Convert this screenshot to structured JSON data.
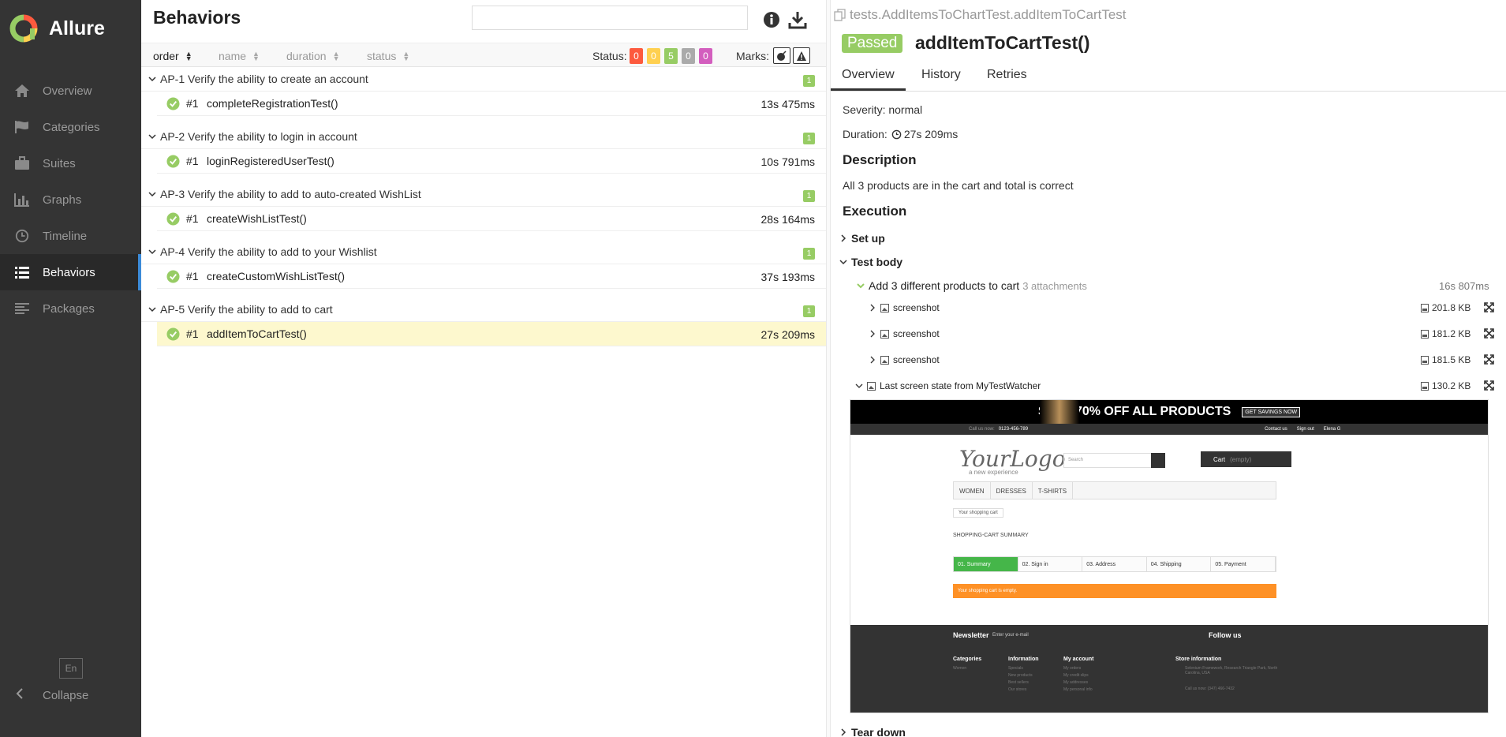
{
  "app": {
    "name": "Allure"
  },
  "colors": {
    "sidebar": "#343434",
    "accent": "#3b8ad8",
    "passed": "#97cc64",
    "failed": "#fd5a3e",
    "broken": "#ffd050",
    "skipped": "#aaaaaa",
    "unknown": "#d35ebe",
    "selected_row": "#fdf8ce"
  },
  "sidebar": {
    "items": [
      {
        "label": "Overview",
        "icon": "home-icon"
      },
      {
        "label": "Categories",
        "icon": "flag-icon"
      },
      {
        "label": "Suites",
        "icon": "briefcase-icon"
      },
      {
        "label": "Graphs",
        "icon": "bar-chart-icon"
      },
      {
        "label": "Timeline",
        "icon": "clock-icon"
      },
      {
        "label": "Behaviors",
        "icon": "list-icon",
        "active": true
      },
      {
        "label": "Packages",
        "icon": "align-left-icon"
      }
    ],
    "language": "En",
    "collapse": "Collapse"
  },
  "behaviors": {
    "title": "Behaviors",
    "search_value": "",
    "sort": {
      "order": "order",
      "name": "name",
      "duration": "duration",
      "status": "status"
    },
    "status_label": "Status:",
    "status_counts": {
      "failed": "0",
      "broken": "0",
      "passed": "5",
      "skipped": "0",
      "unknown": "0"
    },
    "marks_label": "Marks:",
    "groups": [
      {
        "name": "AP-1 Verify the ability to create an account",
        "count": "1",
        "test": {
          "num": "#1",
          "name": "completeRegistrationTest()",
          "duration": "13s 475ms"
        }
      },
      {
        "name": "AP-2 Verify the ability to login in account",
        "count": "1",
        "test": {
          "num": "#1",
          "name": "loginRegisteredUserTest()",
          "duration": "10s 791ms"
        }
      },
      {
        "name": "AP-3 Verify the ability to add to auto-created WishList",
        "count": "1",
        "test": {
          "num": "#1",
          "name": "createWishListTest()",
          "duration": "28s 164ms"
        }
      },
      {
        "name": "AP-4 Verify the ability to add to your Wishlist",
        "count": "1",
        "test": {
          "num": "#1",
          "name": "createCustomWishListTest()",
          "duration": "37s 193ms"
        }
      },
      {
        "name": "AP-5 Verify the ability to add to cart",
        "count": "1",
        "test": {
          "num": "#1",
          "name": "addItemToCartTest()",
          "duration": "27s 209ms"
        }
      }
    ]
  },
  "detail": {
    "fullname": "tests.AddItemsToChartTest.addItemToCartTest",
    "status": "Passed",
    "title": "addItemToCartTest()",
    "tabs": [
      "Overview",
      "History",
      "Retries"
    ],
    "severity": "Severity: normal",
    "duration_label": "Duration:",
    "duration": "27s 209ms",
    "description_heading": "Description",
    "description": "All 3 products are in the cart and total is correct",
    "execution_heading": "Execution",
    "setup": "Set up",
    "test_body": "Test body",
    "step": {
      "name": "Add 3 different products to cart",
      "attachments": "3 attachments",
      "duration": "16s 807ms"
    },
    "attachments": [
      {
        "name": "screenshot",
        "size": "201.8 KB"
      },
      {
        "name": "screenshot",
        "size": "181.2 KB"
      },
      {
        "name": "screenshot",
        "size": "181.5 KB"
      }
    ],
    "last_attachment": {
      "name": "Last screen state from MyTestWatcher",
      "size": "130.2 KB"
    },
    "teardown": "Tear down"
  },
  "screenshot": {
    "promo": "SALE 70% OFF ALL PRODUCTS",
    "promo_button": "GET SAVINGS NOW",
    "call": "Call us now:",
    "phone": "0123-456-789",
    "contact": "Contact us",
    "signout": "Sign out",
    "user": "Elena G",
    "logo": "YourLogo",
    "tagline": "a new experience",
    "search_placeholder": "Search",
    "cart": "Cart",
    "cart_empty": "(empty)",
    "menu": [
      "WOMEN",
      "DRESSES",
      "T-SHIRTS"
    ],
    "breadcrumb": "Your shopping cart",
    "summary_title": "SHOPPING-CART SUMMARY",
    "steps": [
      "01. Summary",
      "02. Sign in",
      "03. Address",
      "04. Shipping",
      "05. Payment"
    ],
    "alert": "Your shopping cart is empty.",
    "newsletter": "Newsletter",
    "newsletter_placeholder": "Enter your e-mail",
    "follow": "Follow us",
    "footer_cols": [
      {
        "title": "Categories",
        "items": [
          "Women"
        ]
      },
      {
        "title": "Information",
        "items": [
          "Specials",
          "New products",
          "Best sellers",
          "Our stores"
        ]
      },
      {
        "title": "My account",
        "items": [
          "My orders",
          "My credit slips",
          "My addresses",
          "My personal info"
        ]
      },
      {
        "title": "Store information",
        "items": [
          "Selenium Framework, Research Triangle Park, North Carolina, USA",
          "Call us now: (347) 466-7432"
        ]
      }
    ]
  }
}
